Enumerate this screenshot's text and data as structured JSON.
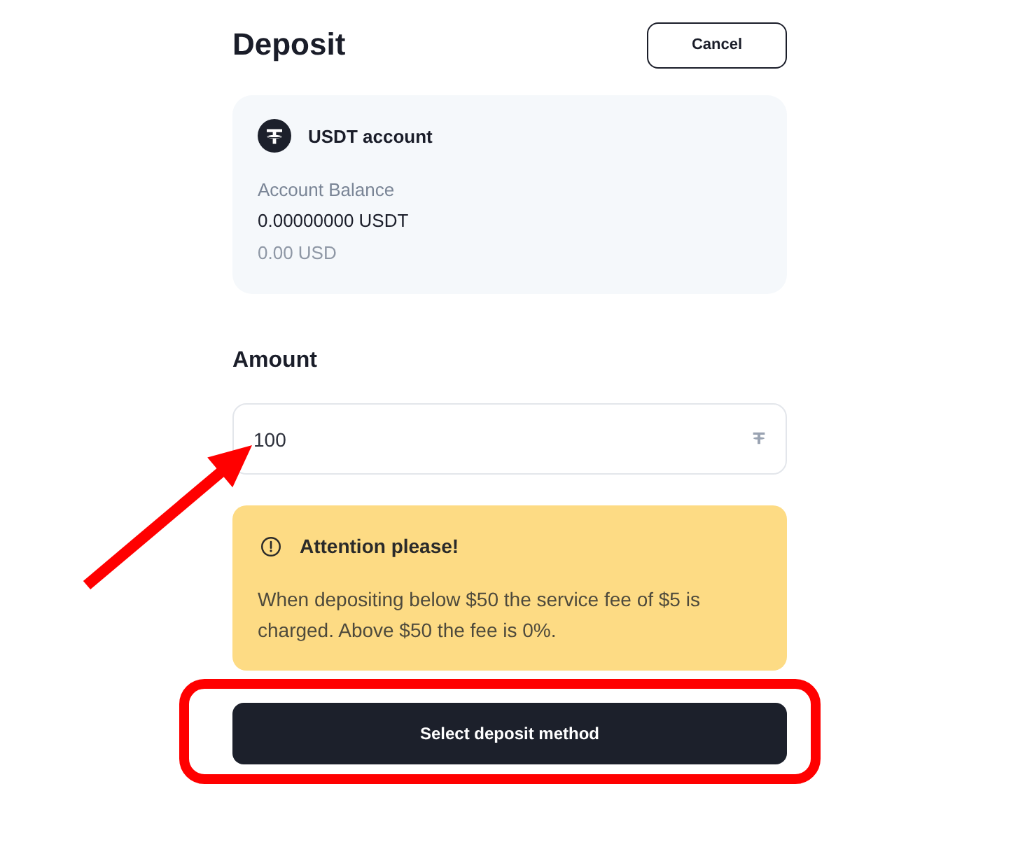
{
  "header": {
    "title": "Deposit",
    "cancel_button": "Cancel"
  },
  "account_card": {
    "name": "USDT account",
    "balance_label": "Account Balance",
    "balance": "0.00000000 USDT",
    "balance_usd": "0.00 USD"
  },
  "amount": {
    "label": "Amount",
    "value": "100",
    "annotation": {
      "kind": "arrow"
    }
  },
  "alert": {
    "title": "Attention please!",
    "message": "When depositing below $50 the service fee of $5 is charged. Above $50 the fee is 0%."
  },
  "primary_button": {
    "label": "Select deposit method",
    "annotation": {
      "kind": "outline"
    }
  }
}
